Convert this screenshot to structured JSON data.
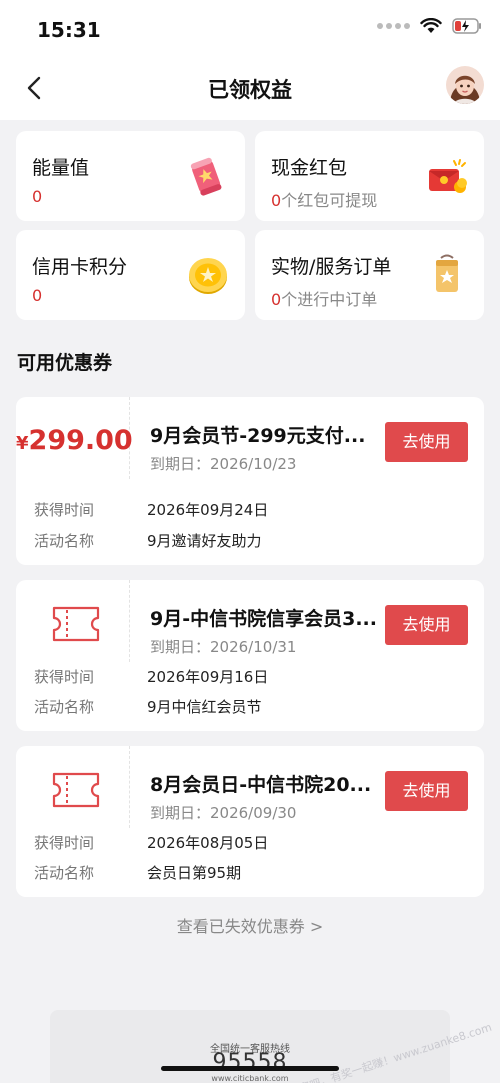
{
  "status_bar": {
    "time": "15:31"
  },
  "nav": {
    "title": "已领权益"
  },
  "tiles": [
    {
      "title": "能量值",
      "value": "0",
      "suffix": "",
      "icon": "energy-scroll-icon"
    },
    {
      "title": "现金红包",
      "value": "0",
      "suffix": "个红包可提现",
      "icon": "red-envelope-icon"
    },
    {
      "title": "信用卡积分",
      "value": "0",
      "suffix": "",
      "icon": "gold-coin-icon"
    },
    {
      "title": "实物/服务订单",
      "value": "0",
      "suffix": "个进行中订单",
      "icon": "order-bag-icon"
    }
  ],
  "section": {
    "title": "可用优惠券"
  },
  "coupons": [
    {
      "currency": "¥",
      "amount": "299.00",
      "name": "9月会员节-299元支付...",
      "expiry": "到期日：2026/10/23",
      "button": "去使用",
      "obtained_label": "获得时间",
      "obtained_value": "2026年09月24日",
      "activity_label": "活动名称",
      "activity_value": "9月邀请好友助力"
    },
    {
      "name": "9月-中信书院信享会员3...",
      "expiry": "到期日：2026/10/31",
      "button": "去使用",
      "obtained_label": "获得时间",
      "obtained_value": "2026年09月16日",
      "activity_label": "活动名称",
      "activity_value": "9月中信红会员节"
    },
    {
      "name": "8月会员日-中信书院20...",
      "expiry": "到期日：2026/09/30",
      "button": "去使用",
      "obtained_label": "获得时间",
      "obtained_value": "2026年08月05日",
      "activity_label": "活动名称",
      "activity_value": "会员日第95期"
    }
  ],
  "expired_link": "查看已失效优惠券 >",
  "footer": {
    "hotline_label": "全国统一客服热线",
    "hotline": "95558",
    "url": "www.citicbank.com"
  },
  "watermark": "赚客吧，有奖一起赚！www.zuanke8.com",
  "colors": {
    "accent": "#e04a4c",
    "value_red": "#d6312f",
    "background": "#f2f2f4"
  }
}
